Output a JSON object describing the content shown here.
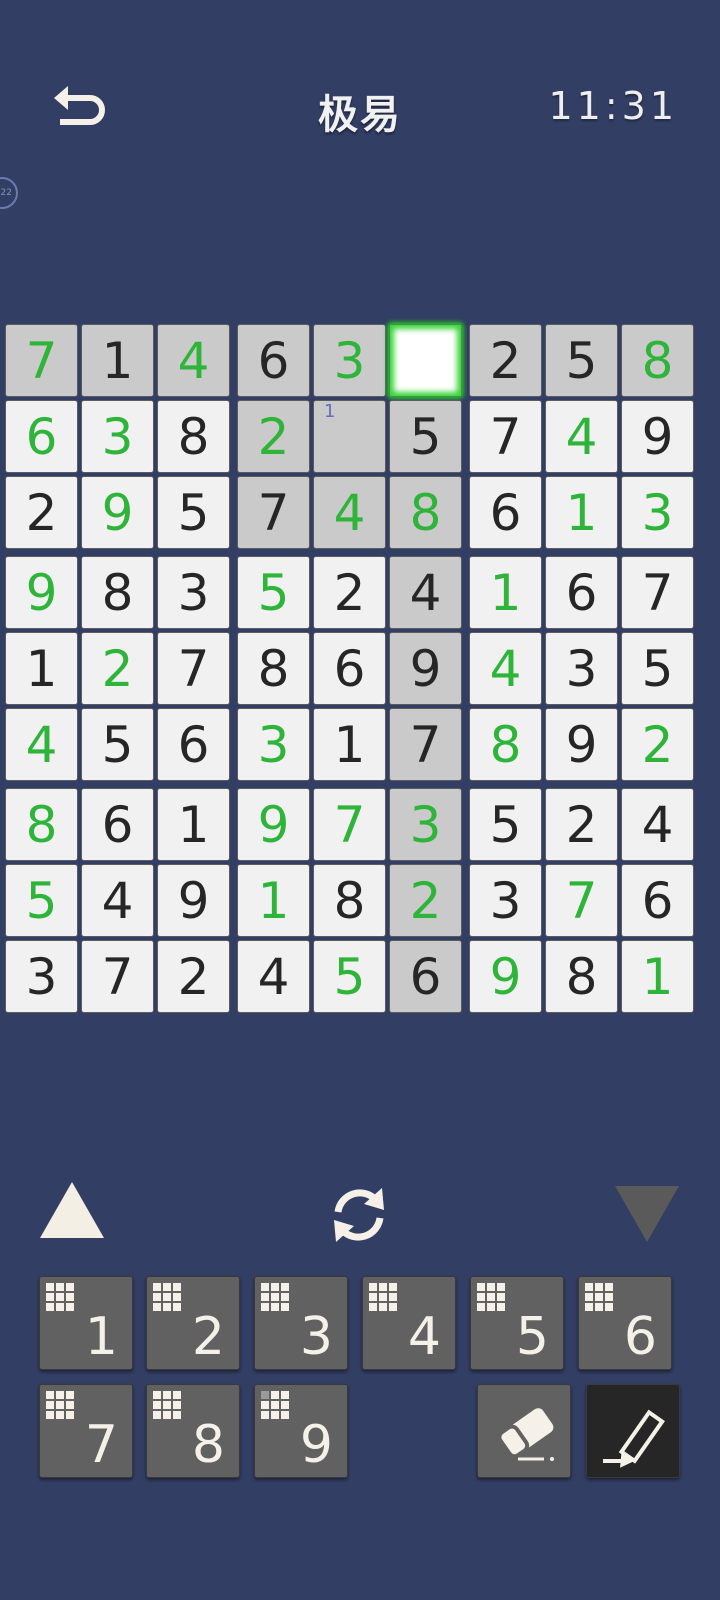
{
  "header": {
    "back_icon": "undo-arrow-icon",
    "title": "极易",
    "timer": "11:31"
  },
  "side_badge": {
    "text": "22"
  },
  "board": {
    "selected": [
      0,
      5
    ],
    "note": {
      "row": 1,
      "col": 4,
      "text": "1"
    },
    "highlighted": [
      [
        0,
        0
      ],
      [
        0,
        1
      ],
      [
        0,
        2
      ],
      [
        0,
        3
      ],
      [
        0,
        4
      ],
      [
        0,
        6
      ],
      [
        0,
        7
      ],
      [
        0,
        8
      ],
      [
        1,
        3
      ],
      [
        1,
        4
      ],
      [
        1,
        5
      ],
      [
        2,
        3
      ],
      [
        2,
        4
      ],
      [
        2,
        5
      ],
      [
        3,
        5
      ],
      [
        4,
        5
      ],
      [
        5,
        5
      ],
      [
        6,
        5
      ],
      [
        7,
        5
      ],
      [
        8,
        5
      ]
    ],
    "values": [
      [
        "7",
        "1",
        "4",
        "6",
        "3",
        "",
        "2",
        "5",
        "8"
      ],
      [
        "6",
        "3",
        "8",
        "2",
        "",
        "5",
        "7",
        "4",
        "9"
      ],
      [
        "2",
        "9",
        "5",
        "7",
        "4",
        "8",
        "6",
        "1",
        "3"
      ],
      [
        "9",
        "8",
        "3",
        "5",
        "2",
        "4",
        "1",
        "6",
        "7"
      ],
      [
        "1",
        "2",
        "7",
        "8",
        "6",
        "9",
        "4",
        "3",
        "5"
      ],
      [
        "4",
        "5",
        "6",
        "3",
        "1",
        "7",
        "8",
        "9",
        "2"
      ],
      [
        "8",
        "6",
        "1",
        "9",
        "7",
        "3",
        "5",
        "2",
        "4"
      ],
      [
        "5",
        "4",
        "9",
        "1",
        "8",
        "2",
        "3",
        "7",
        "6"
      ],
      [
        "3",
        "7",
        "2",
        "4",
        "5",
        "6",
        "9",
        "8",
        "1"
      ]
    ],
    "kind": [
      [
        "u",
        "g",
        "u",
        "g",
        "u",
        "s",
        "g",
        "g",
        "u"
      ],
      [
        "u",
        "u",
        "g",
        "u",
        "n",
        "g",
        "g",
        "u",
        "g"
      ],
      [
        "g",
        "u",
        "g",
        "g",
        "u",
        "u",
        "g",
        "u",
        "u"
      ],
      [
        "u",
        "g",
        "g",
        "u",
        "g",
        "g",
        "u",
        "g",
        "g"
      ],
      [
        "g",
        "u",
        "g",
        "g",
        "g",
        "g",
        "u",
        "g",
        "g"
      ],
      [
        "u",
        "g",
        "g",
        "u",
        "g",
        "g",
        "u",
        "g",
        "u"
      ],
      [
        "u",
        "g",
        "g",
        "u",
        "u",
        "u",
        "g",
        "g",
        "g"
      ],
      [
        "u",
        "g",
        "g",
        "u",
        "g",
        "u",
        "g",
        "u",
        "g"
      ],
      [
        "g",
        "g",
        "g",
        "g",
        "u",
        "g",
        "u",
        "g",
        "u"
      ]
    ],
    "colors": {
      "given": "#262626",
      "user": "#2fb43a",
      "highlight": "#cacaca",
      "cell": "#f1f1f1",
      "selected_glow": "#3bd33b"
    }
  },
  "tools": {
    "prev_icon": "triangle-up-icon",
    "refresh_icon": "refresh-icon",
    "next_icon": "triangle-down-icon"
  },
  "keypad": {
    "digits": [
      "1",
      "2",
      "3",
      "4",
      "5",
      "6",
      "7",
      "8",
      "9"
    ],
    "eraser_icon": "eraser-icon",
    "pencil_icon": "pencil-icon"
  }
}
